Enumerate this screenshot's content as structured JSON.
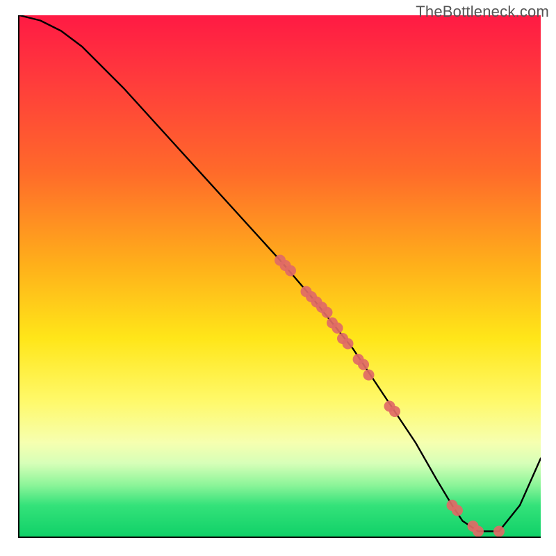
{
  "watermark": "TheBottleneck.com",
  "plot_css": {
    "gradient_stops": [
      {
        "pos": 0,
        "color": "#ff1a44"
      },
      {
        "pos": 12,
        "color": "#ff3a3c"
      },
      {
        "pos": 30,
        "color": "#ff6a2a"
      },
      {
        "pos": 48,
        "color": "#ffb01a"
      },
      {
        "pos": 62,
        "color": "#ffe619"
      },
      {
        "pos": 74,
        "color": "#fff96a"
      },
      {
        "pos": 82,
        "color": "#f6ffb0"
      },
      {
        "pos": 86,
        "color": "#d6ffb8"
      },
      {
        "pos": 90,
        "color": "#8ef59a"
      },
      {
        "pos": 94,
        "color": "#34e27a"
      },
      {
        "pos": 100,
        "color": "#10d168"
      }
    ],
    "curve_stroke": "#000000",
    "curve_width": 2.4,
    "point_fill": "#e06a66",
    "point_radius": 8
  },
  "chart_data": {
    "type": "line",
    "title": "",
    "xlabel": "",
    "ylabel": "",
    "xlim": [
      0,
      100
    ],
    "ylim": [
      0,
      100
    ],
    "grid": false,
    "legend": false,
    "background_gradient": "red-yellow-green vertical, red=bad high bottleneck at top, green=no bottleneck at bottom",
    "series": [
      {
        "name": "bottleneck-curve",
        "kind": "line",
        "x": [
          0,
          4,
          8,
          12,
          20,
          30,
          40,
          50,
          56,
          60,
          64,
          68,
          72,
          76,
          80,
          83,
          85,
          88,
          92,
          96,
          100
        ],
        "y": [
          100,
          99,
          97,
          94,
          86,
          75,
          64,
          53,
          46,
          41,
          36,
          30,
          24,
          18,
          11,
          6,
          3,
          1,
          1,
          6,
          15
        ]
      },
      {
        "name": "sample-points",
        "kind": "scatter",
        "x": [
          50,
          51,
          52,
          55,
          56,
          57,
          58,
          59,
          60,
          61,
          62,
          63,
          65,
          66,
          67,
          71,
          72,
          83,
          84,
          87,
          88,
          92
        ],
        "y": [
          53,
          52,
          51,
          47,
          46,
          45,
          44,
          43,
          41,
          40,
          38,
          37,
          34,
          33,
          31,
          25,
          24,
          6,
          5,
          2,
          1,
          1
        ]
      }
    ]
  }
}
